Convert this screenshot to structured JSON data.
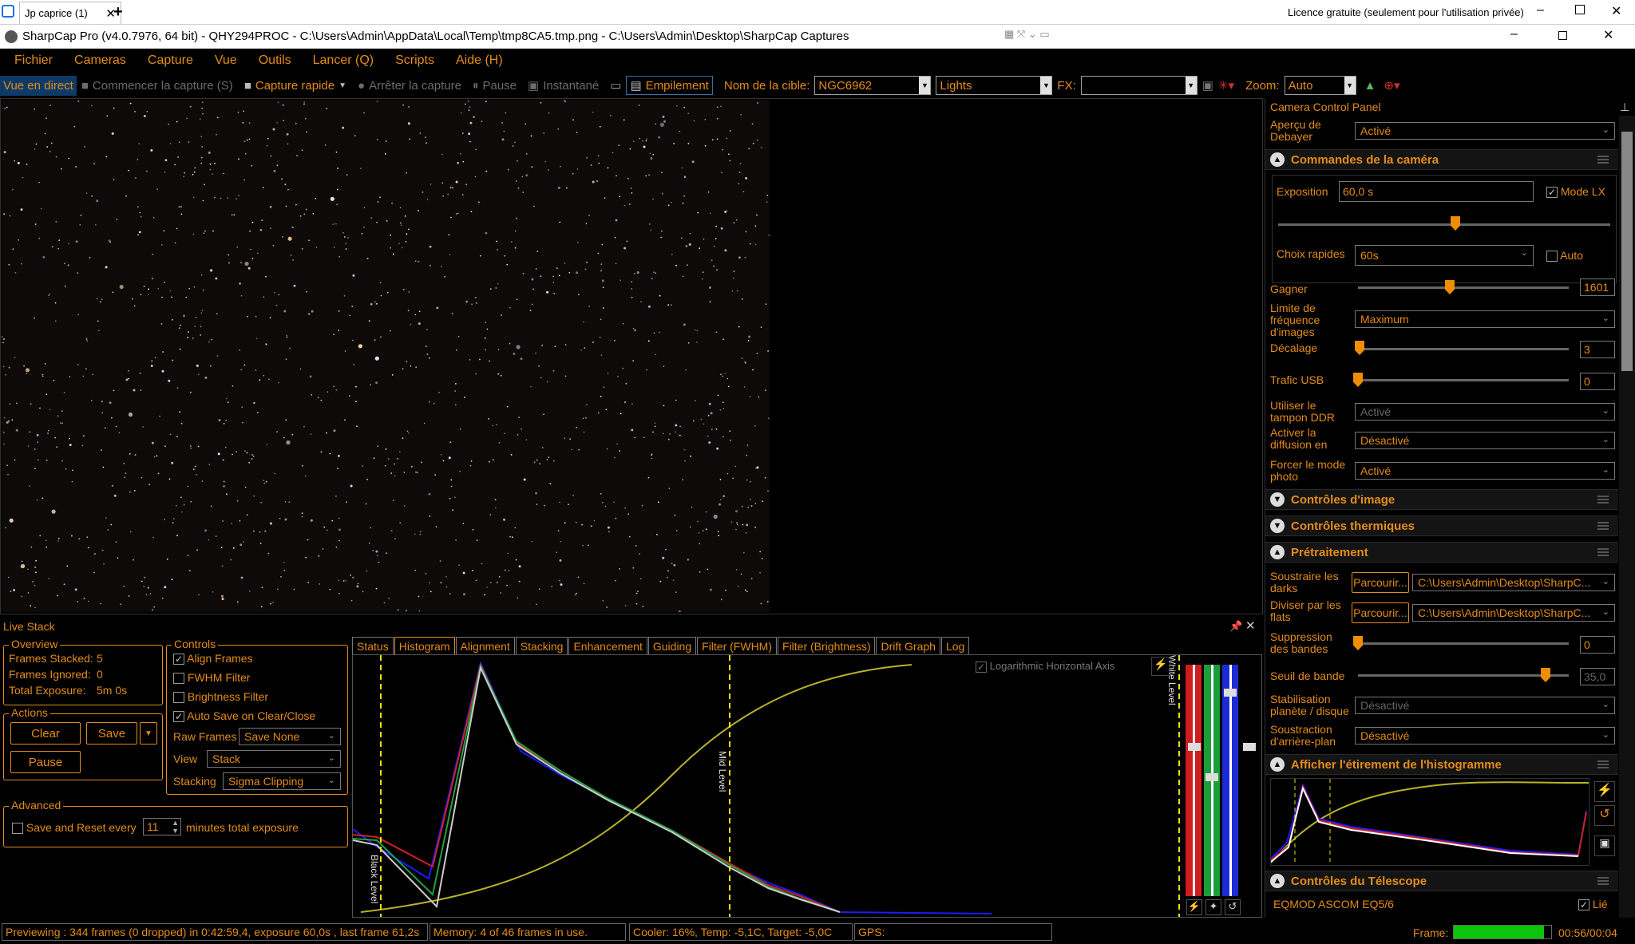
{
  "rdp": {
    "tab_label": "Jp caprice (1)",
    "license": "Licence gratuite (seulement pour l'utilisation privée)"
  },
  "app": {
    "title": "SharpCap Pro (v4.0.7976, 64 bit) - QHY294PROC - C:\\Users\\Admin\\AppData\\Local\\Temp\\tmp8CA5.tmp.png - C:\\Users\\Admin\\Desktop\\SharpCap Captures"
  },
  "menu": [
    "Fichier",
    "Cameras",
    "Capture",
    "Vue",
    "Outils",
    "Lancer (Q)",
    "Scripts",
    "Aide (H)"
  ],
  "toolbar": {
    "live": "Vue en direct",
    "start_capture": "Commencer la capture (S)",
    "quick_capture": "Capture rapide",
    "stop_capture": "Arrêter la capture",
    "pause": "Pause",
    "snapshot": "Instantané",
    "stack": "Empilement",
    "target_label": "Nom de la cible:",
    "target_value": "NGC6962",
    "frame_type": "Lights",
    "fx_label": "FX:",
    "fx_value": "",
    "zoom_label": "Zoom:",
    "zoom_value": "Auto"
  },
  "livestack": {
    "title": "Live Stack",
    "overview": {
      "title": "Overview",
      "frames_stacked_label": "Frames Stacked:",
      "frames_stacked": "5",
      "frames_ignored_label": "Frames Ignored:",
      "frames_ignored": "0",
      "total_exposure_label": "Total Exposure:",
      "total_exposure": "5m 0s"
    },
    "actions": {
      "title": "Actions",
      "clear": "Clear",
      "save": "Save",
      "pause": "Pause"
    },
    "controls": {
      "title": "Controls",
      "align": "Align Frames",
      "fwhm": "FWHM Filter",
      "brightness": "Brightness Filter",
      "autosave": "Auto Save on Clear/Close",
      "raw_frames_label": "Raw Frames",
      "raw_frames_value": "Save None",
      "view_label": "View",
      "view_value": "Stack",
      "stacking_label": "Stacking",
      "stacking_value": "Sigma Clipping"
    },
    "advanced": {
      "title": "Advanced",
      "save_reset": "Save and Reset every",
      "minutes_value": "11",
      "minutes_label": "minutes total exposure"
    },
    "tabs": [
      "Status",
      "Histogram",
      "Alignment",
      "Stacking",
      "Enhancement",
      "Guiding",
      "Filter (FWHM)",
      "Filter (Brightness)",
      "Drift Graph",
      "Log"
    ],
    "histogram": {
      "log_axis": "Logarithmic Horizontal Axis",
      "black_level": "Black Level",
      "mid_level": "Mid Level",
      "white_level": "White Level"
    }
  },
  "panel": {
    "title": "Camera Control Panel",
    "debayer_label": "Aperçu de Debayer",
    "debayer_value": "Activé",
    "sec_camera": "Commandes de la caméra",
    "exposure_label": "Exposition",
    "exposure_value": "60,0 s",
    "lx_mode": "Mode LX",
    "quick_label": "Choix rapides",
    "quick_value": "60s",
    "auto": "Auto",
    "gain_label": "Gagner",
    "gain_value": "1601",
    "fps_label": "Limite de fréquence d'images",
    "fps_value": "Maximum",
    "offset_label": "Décalage",
    "offset_value": "3",
    "usb_label": "Trafic USB",
    "usb_value": "0",
    "ddr_label": "Utiliser le tampon DDR",
    "ddr_value": "Activé",
    "stream_label": "Activer la diffusion en direct",
    "stream_value": "Désactivé",
    "photo_label": "Forcer le mode photo",
    "photo_value": "Activé",
    "sec_image": "Contrôles d'image",
    "sec_thermal": "Contrôles thermiques",
    "sec_preproc": "Prétraitement",
    "darks_label": "Soustraire les darks",
    "darks_btn": "Parcourir...",
    "darks_path": "C:\\Users\\Admin\\Desktop\\SharpC...",
    "flats_label": "Diviser par les flats",
    "flats_btn": "Parcourir...",
    "flats_path": "C:\\Users\\Admin\\Desktop\\SharpC...",
    "banding_label": "Suppression des bandes",
    "banding_value": "0",
    "band_threshold_label": "Seuil de bande",
    "band_threshold_value": "35,0",
    "stab_label": "Stabilisation planète / disque",
    "stab_value": "Désactivé",
    "bg_label": "Soustraction d'arrière-plan",
    "bg_value": "Désactivé",
    "sec_stretch": "Afficher l'étirement de l'histogramme",
    "sec_telescope": "Contrôles du Télescope",
    "telescope_value": "EQMOD ASCOM EQ5/6",
    "linked": "Lié"
  },
  "status": {
    "preview": "Previewing : 344 frames (0 dropped) in 0:42:59,4, exposure 60,0s , last frame 61,2s",
    "memory": "Memory: 4 of 46 frames in use.",
    "cooler": "Cooler: 16%, Temp: -5,1C, Target: -5,0C",
    "gps": "GPS:",
    "frame_label": "Frame:",
    "frame_time": "00:56/00:04",
    "frame_progress": 0.93
  }
}
